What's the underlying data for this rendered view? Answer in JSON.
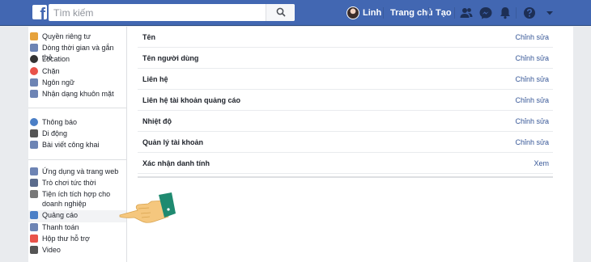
{
  "topbar": {
    "logo_letter": "f",
    "search_placeholder": "Tìm kiếm",
    "user_name": "Linh",
    "home_label": "Trang chủ",
    "create_label": "Tạo",
    "icons": [
      "friends-icon",
      "messenger-icon",
      "notifications-icon",
      "help-icon",
      "dropdown-caret-icon"
    ]
  },
  "sidebar": {
    "group1": [
      {
        "label": "Quyền riêng tư",
        "icon": "lock-icon",
        "color": "#e6a23c"
      },
      {
        "label": "Dòng thời gian và gắn thẻ",
        "icon": "timeline-icon",
        "color": "#6d84b4"
      },
      {
        "label": "Location",
        "icon": "location-icon",
        "color": "#333333"
      },
      {
        "label": "Chặn",
        "icon": "block-icon",
        "color": "#e9534a"
      },
      {
        "label": "Ngôn ngữ",
        "icon": "language-icon",
        "color": "#6d84b4"
      },
      {
        "label": "Nhận dạng khuôn mặt",
        "icon": "face-recognition-icon",
        "color": "#6d84b4"
      }
    ],
    "group2": [
      {
        "label": "Thông báo",
        "icon": "globe-icon",
        "color": "#4b7fc6"
      },
      {
        "label": "Di động",
        "icon": "mobile-icon",
        "color": "#555555"
      },
      {
        "label": "Bài viết công khai",
        "icon": "rss-icon",
        "color": "#6d84b4"
      }
    ],
    "group3": [
      {
        "label": "Ứng dụng và trang web",
        "icon": "apps-icon",
        "color": "#6d84b4"
      },
      {
        "label": "Trò chơi tức thời",
        "icon": "games-icon",
        "color": "#5a6b8c"
      },
      {
        "label": "Tiện ích tích hợp cho doanh nghiệp",
        "icon": "business-integrations-icon",
        "color": "#777777"
      },
      {
        "label": "Quảng cáo",
        "icon": "ads-icon",
        "color": "#4b7fc6"
      },
      {
        "label": "Thanh toán",
        "icon": "payments-icon",
        "color": "#6d84b4"
      },
      {
        "label": "Hộp thư hỗ trợ",
        "icon": "support-inbox-icon",
        "color": "#e9534a"
      },
      {
        "label": "Video",
        "icon": "video-icon",
        "color": "#555555"
      }
    ]
  },
  "settings": [
    {
      "label": "Tên",
      "action": "Chỉnh sửa"
    },
    {
      "label": "Tên người dùng",
      "action": "Chỉnh sửa"
    },
    {
      "label": "Liên hệ",
      "action": "Chỉnh sửa"
    },
    {
      "label": "Liên hệ tài khoản quảng cáo",
      "action": "Chỉnh sửa"
    },
    {
      "label": "Nhiệt độ",
      "action": "Chỉnh sửa"
    },
    {
      "label": "Quản lý tài khoản",
      "action": "Chỉnh sửa"
    },
    {
      "label": "Xác nhận danh tính",
      "action": "Xem"
    }
  ],
  "colors": {
    "brand_blue": "#4267b2",
    "link_blue": "#385898",
    "hand_skin": "#f5c77e",
    "hand_cuff": "#1f8a70"
  }
}
